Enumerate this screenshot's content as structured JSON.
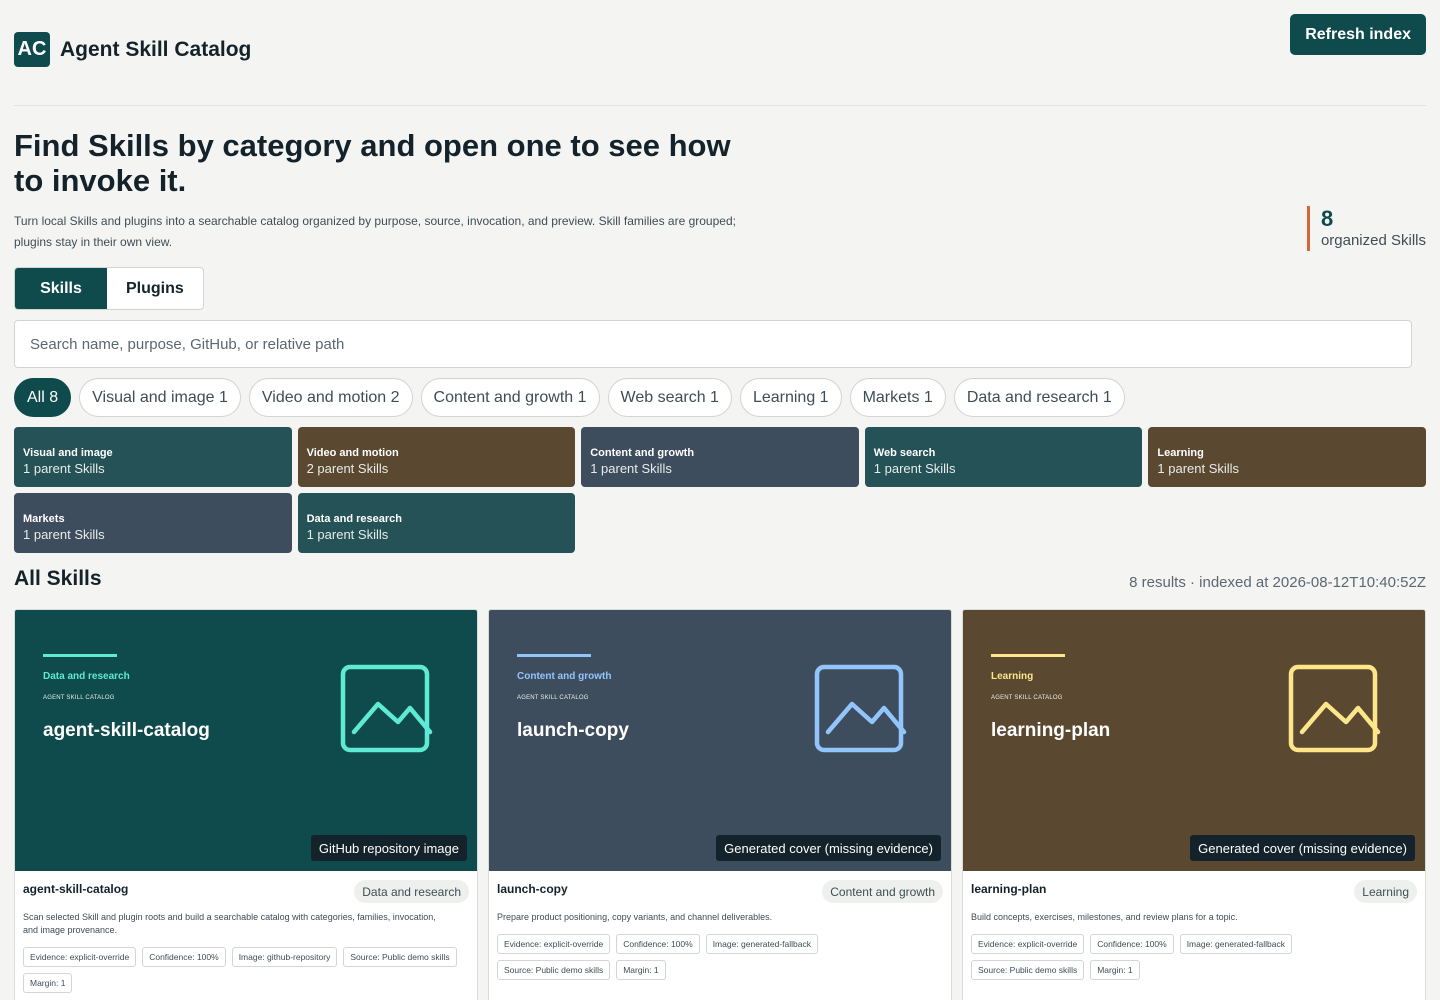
{
  "app": {
    "logo": "AC",
    "title": "Agent Skill Catalog",
    "refresh_label": "Refresh index"
  },
  "hero": {
    "title": "Find Skills by category and open one to see how to invoke it.",
    "description": "Turn local Skills and plugins into a searchable catalog organized by purpose, source, invocation, and preview. Skill families are grouped; plugins stay in their own view."
  },
  "stat": {
    "value": "8",
    "label": "organized Skills"
  },
  "tabs": [
    {
      "label": "Skills",
      "active": true
    },
    {
      "label": "Plugins",
      "active": false
    }
  ],
  "search": {
    "placeholder": "Search name, purpose, GitHub, or relative path",
    "value": ""
  },
  "filters": [
    {
      "label": "All 8",
      "active": true
    },
    {
      "label": "Visual and image 1",
      "active": false
    },
    {
      "label": "Video and motion 2",
      "active": false
    },
    {
      "label": "Content and growth 1",
      "active": false
    },
    {
      "label": "Web search 1",
      "active": false
    },
    {
      "label": "Learning 1",
      "active": false
    },
    {
      "label": "Markets 1",
      "active": false
    },
    {
      "label": "Data and research 1",
      "active": false
    }
  ],
  "categories": [
    {
      "name": "Visual and image",
      "count": "1 parent Skills",
      "color": "#255257"
    },
    {
      "name": "Video and motion",
      "count": "2 parent Skills",
      "color": "#5b4830"
    },
    {
      "name": "Content and growth",
      "count": "1 parent Skills",
      "color": "#3e4d5d"
    },
    {
      "name": "Web search",
      "count": "1 parent Skills",
      "color": "#255257"
    },
    {
      "name": "Learning",
      "count": "1 parent Skills",
      "color": "#5b4830"
    },
    {
      "name": "Markets",
      "count": "1 parent Skills",
      "color": "#3e4d5d"
    },
    {
      "name": "Data and research",
      "count": "1 parent Skills",
      "color": "#255257"
    }
  ],
  "section": {
    "title": "All Skills",
    "meta": "8 results · indexed at 2026-08-12T10:40:52Z"
  },
  "cards": [
    {
      "cover_color": "#0f4a4d",
      "accent": "#5eead4",
      "category": "Data and research",
      "brand": "AGENT SKILL CATALOG",
      "name": "agent-skill-catalog",
      "image_badge": "GitHub repository image",
      "description": "Scan selected Skill and plugin roots and build a searchable catalog with categories, families, invocation, and image provenance.",
      "tags": [
        "Evidence: explicit-override",
        "Confidence: 100%",
        "Image: github-repository",
        "Source: Public demo skills",
        "Margin: 1"
      ]
    },
    {
      "cover_color": "#3e4d5d",
      "accent": "#93c5fd",
      "category": "Content and growth",
      "brand": "AGENT SKILL CATALOG",
      "name": "launch-copy",
      "image_badge": "Generated cover (missing evidence)",
      "description": "Prepare product positioning, copy variants, and channel deliverables.",
      "tags": [
        "Evidence: explicit-override",
        "Confidence: 100%",
        "Image: generated-fallback",
        "Source: Public demo skills",
        "Margin: 1"
      ]
    },
    {
      "cover_color": "#5b4830",
      "accent": "#fde68a",
      "category": "Learning",
      "brand": "AGENT SKILL CATALOG",
      "name": "learning-plan",
      "image_badge": "Generated cover (missing evidence)",
      "description": "Build concepts, exercises, milestones, and review plans for a topic.",
      "tags": [
        "Evidence: explicit-override",
        "Confidence: 100%",
        "Image: generated-fallback",
        "Source: Public demo skills",
        "Margin: 1"
      ]
    }
  ]
}
